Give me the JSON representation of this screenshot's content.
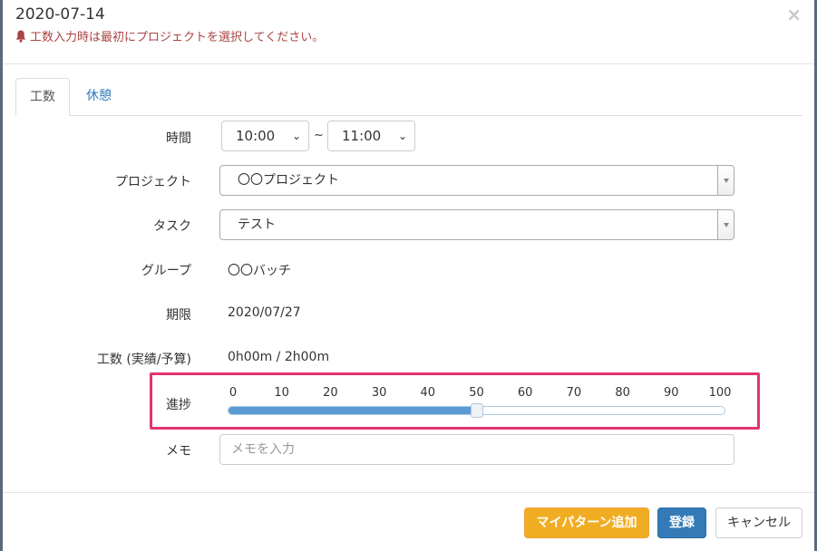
{
  "header": {
    "title": "2020-07-14",
    "alert": "工数入力時は最初にプロジェクトを選択してください。",
    "close": "×"
  },
  "tabs": [
    {
      "label": "工数",
      "active": true
    },
    {
      "label": "休憩",
      "active": false
    }
  ],
  "form": {
    "time": {
      "label": "時間",
      "start": "10:00",
      "separator": "~",
      "end": "11:00"
    },
    "project": {
      "label": "プロジェクト",
      "value": "〇〇プロジェクト"
    },
    "task": {
      "label": "タスク",
      "value": "テスト"
    },
    "group": {
      "label": "グループ",
      "value": "〇〇バッチ"
    },
    "deadline": {
      "label": "期限",
      "value": "2020/07/27"
    },
    "effort": {
      "label": "工数 (実績/予算)",
      "value": "0h00m / 2h00m"
    },
    "progress": {
      "label": "進捗",
      "value": 50,
      "ticks": [
        "0",
        "10",
        "20",
        "30",
        "40",
        "50",
        "60",
        "70",
        "80",
        "90",
        "100"
      ]
    },
    "memo": {
      "label": "メモ",
      "placeholder": "メモを入力",
      "value": ""
    }
  },
  "footer": {
    "add_pattern_label": "マイパターン追加",
    "register_label": "登録",
    "cancel_label": "キャンセル"
  },
  "colors": {
    "alert": "#a94442",
    "highlight": "#e5336f",
    "slider_fill": "#5b9bd5",
    "warning": "#f0ad23",
    "primary": "#337ab7",
    "link": "#337ab7"
  }
}
